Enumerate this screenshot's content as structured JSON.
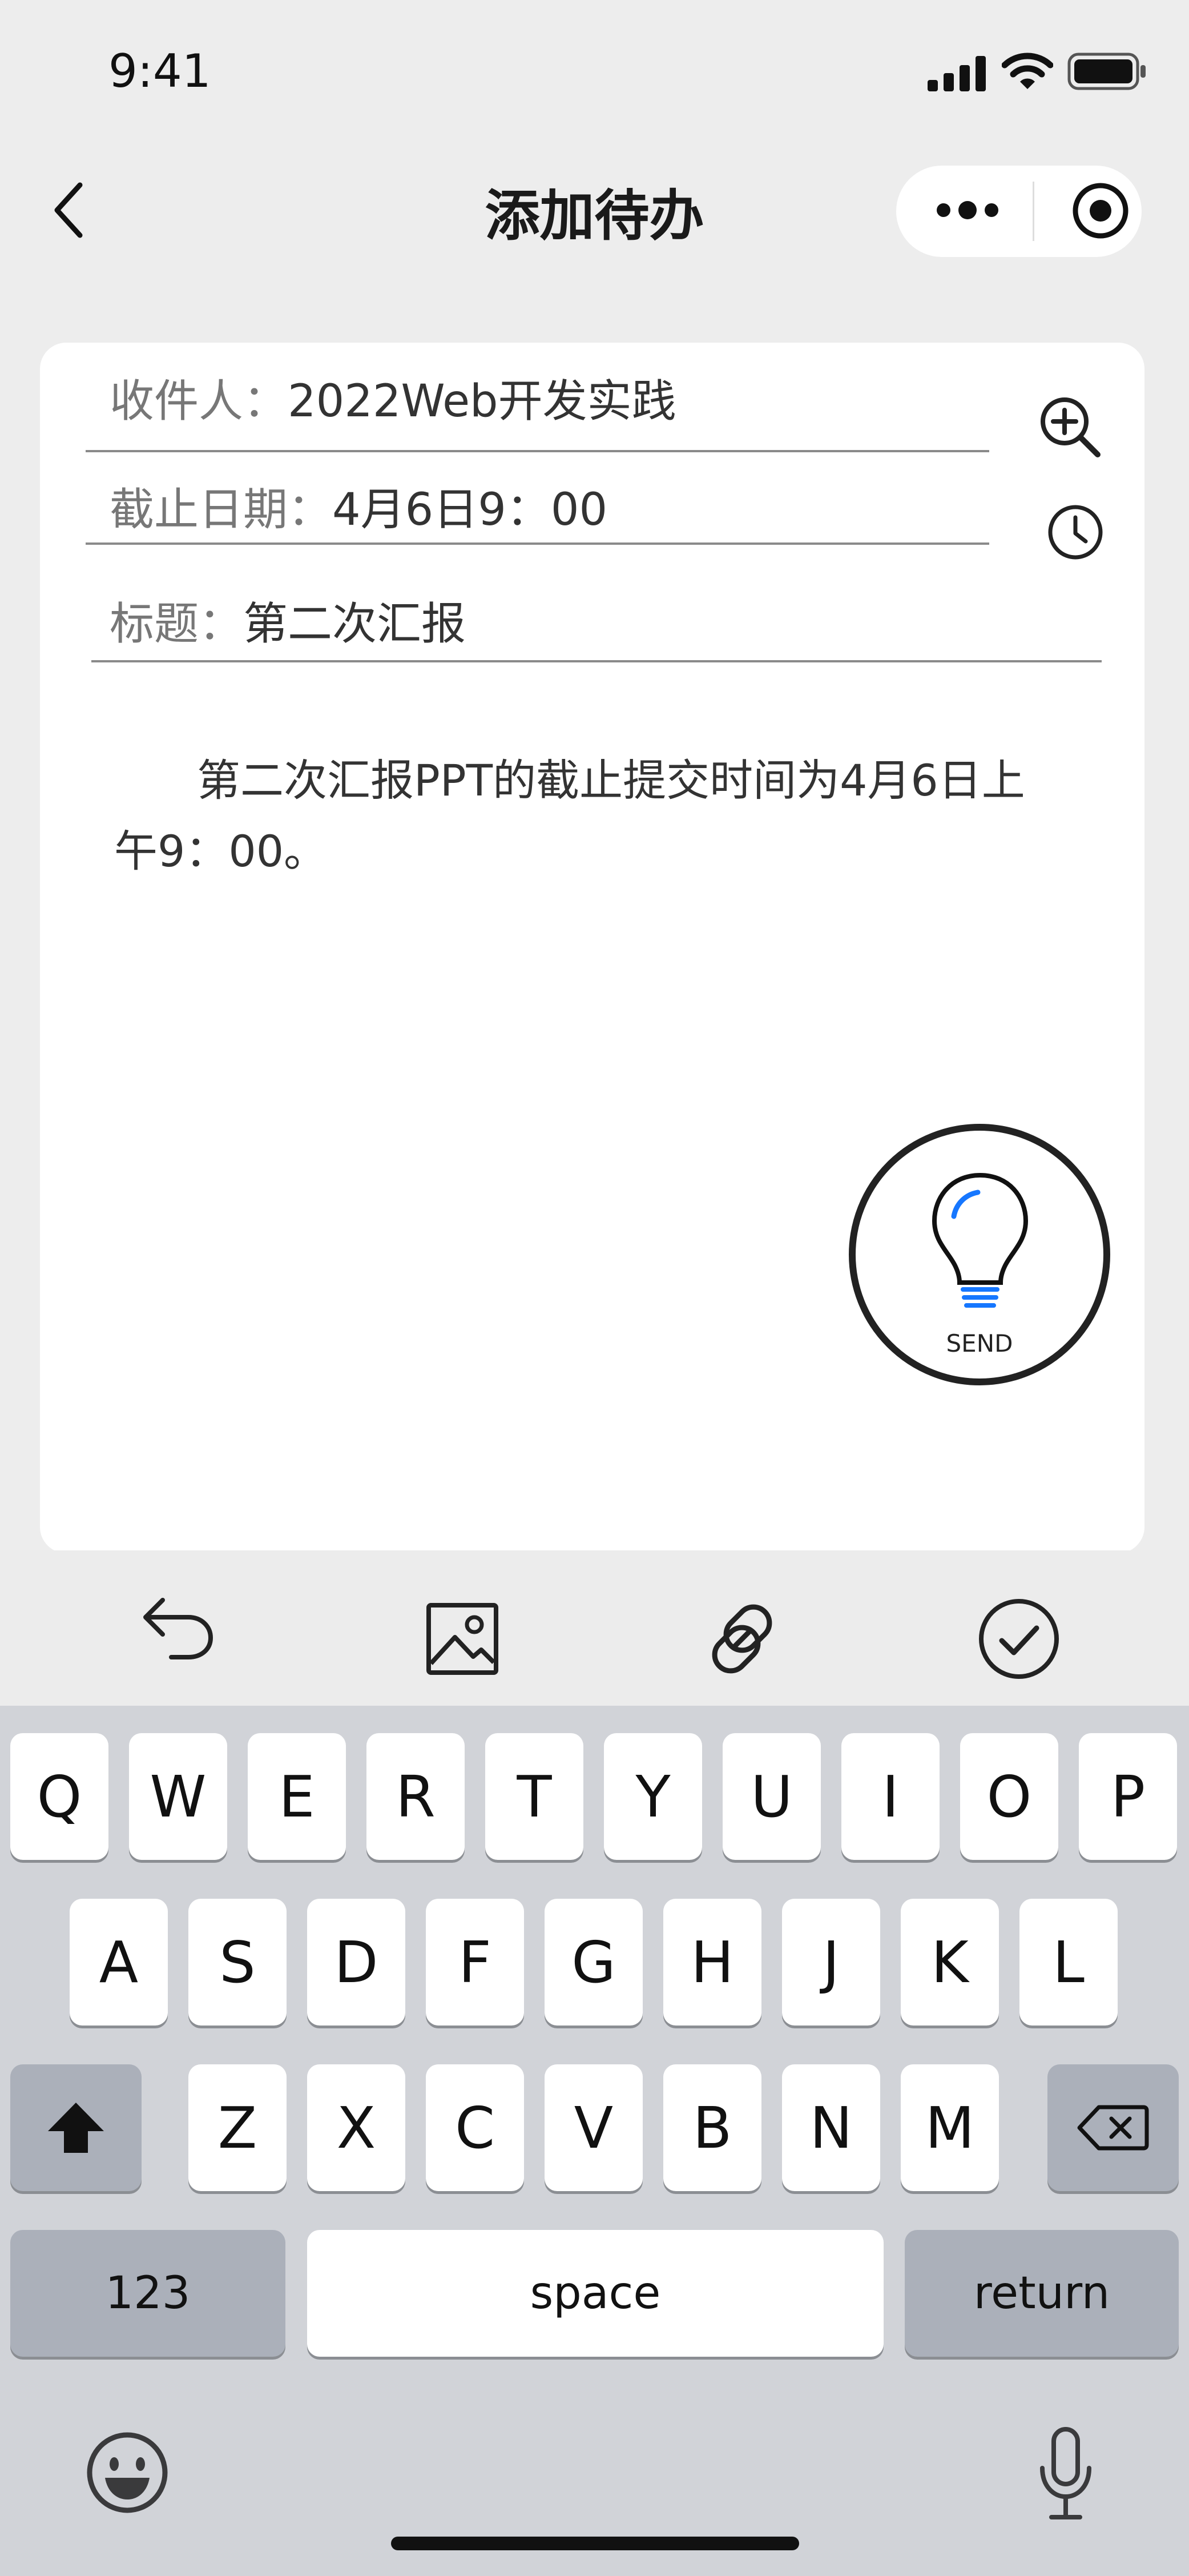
{
  "status_bar": {
    "time": "9:41"
  },
  "nav": {
    "title": "添加待办"
  },
  "form": {
    "recipient_label": "收件人：",
    "recipient_value": "2022Web开发实践",
    "deadline_label": "截止日期：",
    "deadline_value": "4月6日9：00",
    "title_label": "标题：",
    "title_value": "第二次汇报",
    "body_text": "第二次汇报PPT的截止提交时间为4月6日上午9：00。"
  },
  "send_button": {
    "label": "SEND"
  },
  "keyboard": {
    "row1": [
      "Q",
      "W",
      "E",
      "R",
      "T",
      "Y",
      "U",
      "I",
      "O",
      "P"
    ],
    "row2": [
      "A",
      "S",
      "D",
      "F",
      "G",
      "H",
      "J",
      "K",
      "L"
    ],
    "row3": [
      "Z",
      "X",
      "C",
      "V",
      "B",
      "N",
      "M"
    ],
    "numbers_key": "123",
    "space_key": "space",
    "return_key": "return"
  },
  "colors": {
    "accent_blue": "#1677ff",
    "card_bg": "#ffffff",
    "page_bg": "#ededed",
    "keyboard_bg": "#d1d3d8"
  }
}
